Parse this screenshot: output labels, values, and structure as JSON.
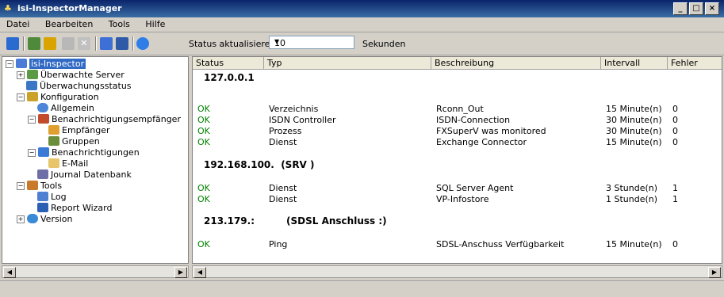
{
  "window": {
    "title": "isi-InspectorManager",
    "app_icon": "app-icon"
  },
  "menu": [
    "Datei",
    "Bearbeiten",
    "Tools",
    "Hilfe"
  ],
  "toolbar": {
    "status_label": "Status aktualisieren:",
    "status_value": "10",
    "unit_label": "Sekunden"
  },
  "tree": [
    {
      "label": "isi-Inspector",
      "icon": "server-root-icon"
    },
    {
      "label": "Überwachte Server",
      "icon": "server-icon"
    },
    {
      "label": "Überwachungsstatus",
      "icon": "monitor-icon"
    },
    {
      "label": "Konfiguration",
      "icon": "config-icon"
    },
    {
      "label": "Allgemein",
      "icon": "general-icon"
    },
    {
      "label": "Benachrichtigungsempfänger",
      "icon": "recipients-icon"
    },
    {
      "label": "Empfänger",
      "icon": "user-icon"
    },
    {
      "label": "Gruppen",
      "icon": "group-icon"
    },
    {
      "label": "Benachrichtigungen",
      "icon": "notification-icon"
    },
    {
      "label": "E-Mail",
      "icon": "mail-icon"
    },
    {
      "label": "Journal Datenbank",
      "icon": "database-icon"
    },
    {
      "label": "Tools",
      "icon": "tools-icon"
    },
    {
      "label": "Log",
      "icon": "log-icon"
    },
    {
      "label": "Report Wizard",
      "icon": "report-icon"
    },
    {
      "label": "Version",
      "icon": "version-icon"
    }
  ],
  "columns": [
    "Status",
    "Typ",
    "Beschreibung",
    "Intervall",
    "Fehler"
  ],
  "groups": [
    {
      "label": "127.0.0.1",
      "suffix": ""
    },
    {
      "label": "192.168.100.",
      "suffix": "(SRV )"
    },
    {
      "label": "213.179.:",
      "suffix": "(SDSL Anschluss :)"
    }
  ],
  "rows": [
    {
      "status": "OK",
      "typ": "Verzeichnis",
      "beschreibung": "Rconn_Out",
      "intervall": "15 Minute(n)",
      "fehler": "0"
    },
    {
      "status": "OK",
      "typ": "ISDN Controller",
      "beschreibung": "ISDN-Connection",
      "intervall": "30 Minute(n)",
      "fehler": "0"
    },
    {
      "status": "OK",
      "typ": "Prozess",
      "beschreibung": "FXSuperV was monitored",
      "intervall": "30 Minute(n)",
      "fehler": "0"
    },
    {
      "status": "OK",
      "typ": "Dienst",
      "beschreibung": "Exchange Connector",
      "intervall": "15 Minute(n)",
      "fehler": "0"
    },
    {
      "status": "OK",
      "typ": "Dienst",
      "beschreibung": "SQL Server Agent",
      "intervall": "3 Stunde(n)",
      "fehler": "1"
    },
    {
      "status": "OK",
      "typ": "Dienst",
      "beschreibung": "VP-Infostore",
      "intervall": "1 Stunde(n)",
      "fehler": "1"
    },
    {
      "status": "OK",
      "typ": "Ping",
      "beschreibung": "SDSL-Anschuss Verfügbarkeit",
      "intervall": "15 Minute(n)",
      "fehler": "0"
    }
  ]
}
